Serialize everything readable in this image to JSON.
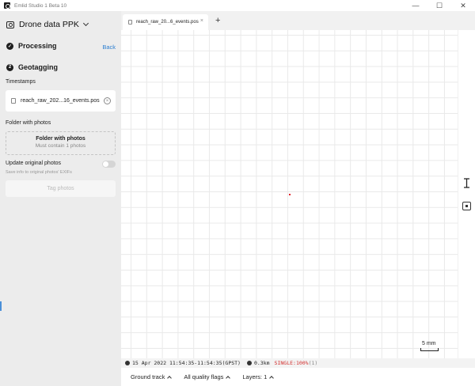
{
  "window": {
    "title": "Emlid Studio 1 Beta 10",
    "controls": {
      "minimize": "—",
      "maximize": "☐",
      "close": "✕"
    }
  },
  "sidebar": {
    "project_title": "Drone data PPK",
    "steps": [
      {
        "number": "✓",
        "label": "Processing",
        "back_label": "Back"
      },
      {
        "number": "2",
        "label": "Geotagging"
      }
    ],
    "timestamps": {
      "label": "Timestamps",
      "file_name": "reach_raw_202...16_events.pos",
      "clear_icon": "×"
    },
    "folder": {
      "label": "Folder with photos",
      "title": "Folder with photos",
      "subtitle": "Must contain 1 photos"
    },
    "update_photos": {
      "label": "Update original photos",
      "note": "Save info to original photos' EXIFs",
      "enabled": false
    },
    "tag_button": "Tag photos"
  },
  "tabs": [
    {
      "label": "reach_raw_20...6_events.pos",
      "close": "×"
    }
  ],
  "tab_add": "+",
  "map": {
    "scale_label": "5 mm",
    "point_color": "#e0242c"
  },
  "status": {
    "time_range": "15 Apr 2022 11:54:35-11:54:35(GPST)",
    "distance": "0.3km",
    "solution": "SINGLE:100%",
    "count": "(1)"
  },
  "bottom": {
    "ground_track": "Ground track",
    "quality_flags": "All quality flags",
    "layers": "Layers: 1"
  },
  "colors": {
    "accent": "#2e7fd0",
    "single_status": "#d2302f"
  }
}
